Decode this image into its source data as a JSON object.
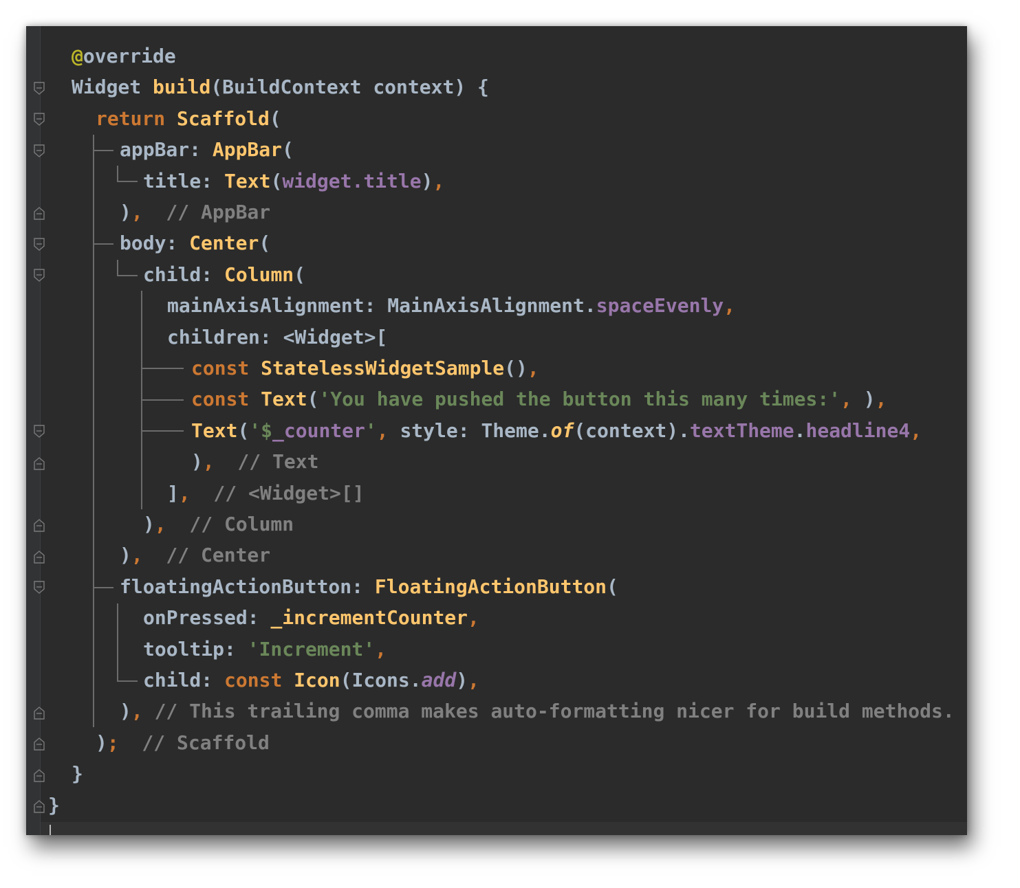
{
  "editor": {
    "colors": {
      "background": "#2b2b2b",
      "gutter": "#313335",
      "default_text": "#a9b7c6",
      "keyword": "#cc7832",
      "class": "#ffc66d",
      "field": "#9876aa",
      "string": "#6a8759",
      "comment": "#808080",
      "annotation": "#bbb529"
    },
    "lines": [
      [
        {
          "t": "@",
          "c": "ann"
        },
        {
          "t": "override",
          "c": "id"
        }
      ],
      [
        {
          "t": "Widget ",
          "c": "id"
        },
        {
          "t": "build",
          "c": "fn"
        },
        {
          "t": "(BuildContext context) {",
          "c": "id"
        }
      ],
      [
        {
          "t": "return ",
          "c": "kw"
        },
        {
          "t": "Scaffold",
          "c": "cls"
        },
        {
          "t": "(",
          "c": "id"
        }
      ],
      [
        {
          "t": "appBar: ",
          "c": "id"
        },
        {
          "t": "AppBar",
          "c": "cls"
        },
        {
          "t": "(",
          "c": "id"
        }
      ],
      [
        {
          "t": "title: ",
          "c": "id"
        },
        {
          "t": "Text",
          "c": "cls"
        },
        {
          "t": "(",
          "c": "id"
        },
        {
          "t": "widget.title",
          "c": "fld"
        },
        {
          "t": ")",
          "c": "id"
        },
        {
          "t": ",",
          "c": "punc"
        }
      ],
      [
        {
          "t": ")",
          "c": "id"
        },
        {
          "t": ",",
          "c": "punc"
        },
        {
          "t": "  // AppBar",
          "c": "cmt"
        }
      ],
      [
        {
          "t": "body: ",
          "c": "id"
        },
        {
          "t": "Center",
          "c": "cls"
        },
        {
          "t": "(",
          "c": "id"
        }
      ],
      [
        {
          "t": "child: ",
          "c": "id"
        },
        {
          "t": "Column",
          "c": "cls"
        },
        {
          "t": "(",
          "c": "id"
        }
      ],
      [
        {
          "t": "mainAxisAlignment: MainAxisAlignment.",
          "c": "id"
        },
        {
          "t": "spaceEvenly",
          "c": "fld"
        },
        {
          "t": ",",
          "c": "punc"
        }
      ],
      [
        {
          "t": "children: <Widget>[",
          "c": "id"
        }
      ],
      [
        {
          "t": "const ",
          "c": "kw"
        },
        {
          "t": "StatelessWidgetSample",
          "c": "cls"
        },
        {
          "t": "()",
          "c": "id"
        },
        {
          "t": ",",
          "c": "punc"
        }
      ],
      [
        {
          "t": "const ",
          "c": "kw"
        },
        {
          "t": "Text",
          "c": "cls"
        },
        {
          "t": "(",
          "c": "id"
        },
        {
          "t": "'You have pushed the button this many times:'",
          "c": "str"
        },
        {
          "t": ",",
          "c": "punc"
        },
        {
          "t": " )",
          "c": "id"
        },
        {
          "t": ",",
          "c": "punc"
        }
      ],
      [
        {
          "t": "Text",
          "c": "cls"
        },
        {
          "t": "(",
          "c": "id"
        },
        {
          "t": "'$",
          "c": "str"
        },
        {
          "t": "_counter",
          "c": "fld"
        },
        {
          "t": "'",
          "c": "str"
        },
        {
          "t": ",",
          "c": "punc"
        },
        {
          "t": " style: Theme.",
          "c": "id"
        },
        {
          "t": "of",
          "c": "fnit"
        },
        {
          "t": "(context).",
          "c": "id"
        },
        {
          "t": "textTheme",
          "c": "fld"
        },
        {
          "t": ".",
          "c": "id"
        },
        {
          "t": "headline4",
          "c": "fld"
        },
        {
          "t": ",",
          "c": "punc"
        }
      ],
      [
        {
          "t": ")",
          "c": "id"
        },
        {
          "t": ",",
          "c": "punc"
        },
        {
          "t": "  // Text",
          "c": "cmt"
        }
      ],
      [
        {
          "t": "]",
          "c": "id"
        },
        {
          "t": ",",
          "c": "punc"
        },
        {
          "t": "  // <Widget>[]",
          "c": "cmt"
        }
      ],
      [
        {
          "t": ")",
          "c": "id"
        },
        {
          "t": ",",
          "c": "punc"
        },
        {
          "t": "  // Column",
          "c": "cmt"
        }
      ],
      [
        {
          "t": ")",
          "c": "id"
        },
        {
          "t": ",",
          "c": "punc"
        },
        {
          "t": "  // Center",
          "c": "cmt"
        }
      ],
      [
        {
          "t": "floatingActionButton: ",
          "c": "id"
        },
        {
          "t": "FloatingActionButton",
          "c": "cls"
        },
        {
          "t": "(",
          "c": "id"
        }
      ],
      [
        {
          "t": "onPressed: ",
          "c": "id"
        },
        {
          "t": "_incrementCounter",
          "c": "cls"
        },
        {
          "t": ",",
          "c": "punc"
        }
      ],
      [
        {
          "t": "tooltip: ",
          "c": "id"
        },
        {
          "t": "'Increment'",
          "c": "str"
        },
        {
          "t": ",",
          "c": "punc"
        }
      ],
      [
        {
          "t": "child: ",
          "c": "id"
        },
        {
          "t": "const ",
          "c": "kw"
        },
        {
          "t": "Icon",
          "c": "cls"
        },
        {
          "t": "(Icons.",
          "c": "id"
        },
        {
          "t": "add",
          "c": "fldit"
        },
        {
          "t": ")",
          "c": "id"
        },
        {
          "t": ",",
          "c": "punc"
        }
      ],
      [
        {
          "t": ")",
          "c": "id"
        },
        {
          "t": ",",
          "c": "punc"
        },
        {
          "t": " // This trailing comma makes auto-formatting nicer for build methods.",
          "c": "cmt"
        }
      ],
      [
        {
          "t": ")",
          "c": "id"
        },
        {
          "t": ";",
          "c": "punc"
        },
        {
          "t": "  // Scaffold",
          "c": "cmt"
        }
      ],
      [
        {
          "t": "}",
          "c": "id"
        }
      ],
      [
        {
          "t": "}",
          "c": "id"
        }
      ]
    ]
  }
}
